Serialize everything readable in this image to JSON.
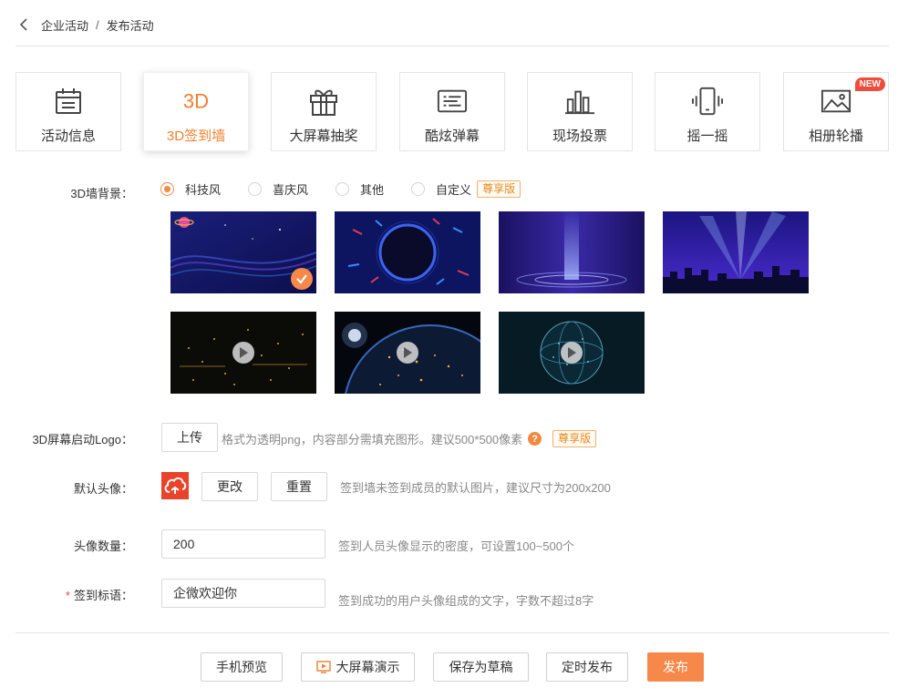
{
  "breadcrumb": {
    "parent": "企业活动",
    "separator": "/",
    "current": "发布活动"
  },
  "tabs": [
    {
      "label": "活动信息",
      "icon": "calendar-icon"
    },
    {
      "label": "3D签到墙",
      "icon": "3d-text-icon",
      "icon_text": "3D",
      "active": true
    },
    {
      "label": "大屏幕抽奖",
      "icon": "gift-icon"
    },
    {
      "label": "酷炫弹幕",
      "icon": "danmaku-icon"
    },
    {
      "label": "现场投票",
      "icon": "bar-chart-icon"
    },
    {
      "label": "摇一摇",
      "icon": "shake-phone-icon"
    },
    {
      "label": "相册轮播",
      "icon": "image-icon",
      "badge": "NEW"
    }
  ],
  "background": {
    "label": "3D墙背景：",
    "options": [
      {
        "label": "科技风",
        "checked": true
      },
      {
        "label": "喜庆风",
        "checked": false
      },
      {
        "label": "其他",
        "checked": false
      },
      {
        "label": "自定义",
        "checked": false
      }
    ],
    "vip_badge": "尊享版",
    "thumbnails": [
      {
        "name": "tech-wave",
        "selected": true,
        "video": false
      },
      {
        "name": "tech-ring",
        "selected": false,
        "video": false
      },
      {
        "name": "tech-beam",
        "selected": false,
        "video": false
      },
      {
        "name": "tech-city-lights",
        "selected": false,
        "video": false
      },
      {
        "name": "dark-particles",
        "selected": false,
        "video": true
      },
      {
        "name": "earth-night",
        "selected": false,
        "video": true
      },
      {
        "name": "digital-globe",
        "selected": false,
        "video": true
      }
    ]
  },
  "logo": {
    "label": "3D屏幕启动Logo：",
    "upload_button": "上传",
    "hint": "格式为透明png，内容部分需填充图形。建议500*500像素",
    "help_icon": "?",
    "vip_badge": "尊享版"
  },
  "default_avatar": {
    "label": "默认头像：",
    "change_button": "更改",
    "reset_button": "重置",
    "hint": "签到墙未签到成员的默认图片，建议尺寸为200x200"
  },
  "avatar_count": {
    "label": "头像数量：",
    "value": "200",
    "hint": "签到人员头像显示的密度，可设置100~500个"
  },
  "slogan": {
    "required_mark": "*",
    "label": "签到标语：",
    "value": "企微欢迎你",
    "hint": "签到成功的用户头像组成的文字，字数不超过8字"
  },
  "footer": {
    "preview_button": "手机预览",
    "bigscreen_button": "大屏幕演示",
    "draft_button": "保存为草稿",
    "schedule_button": "定时发布",
    "publish_button": "发布"
  },
  "colors": {
    "accent": "#f6894a",
    "danger": "#ee4d3d",
    "border": "#e5e5e5"
  }
}
